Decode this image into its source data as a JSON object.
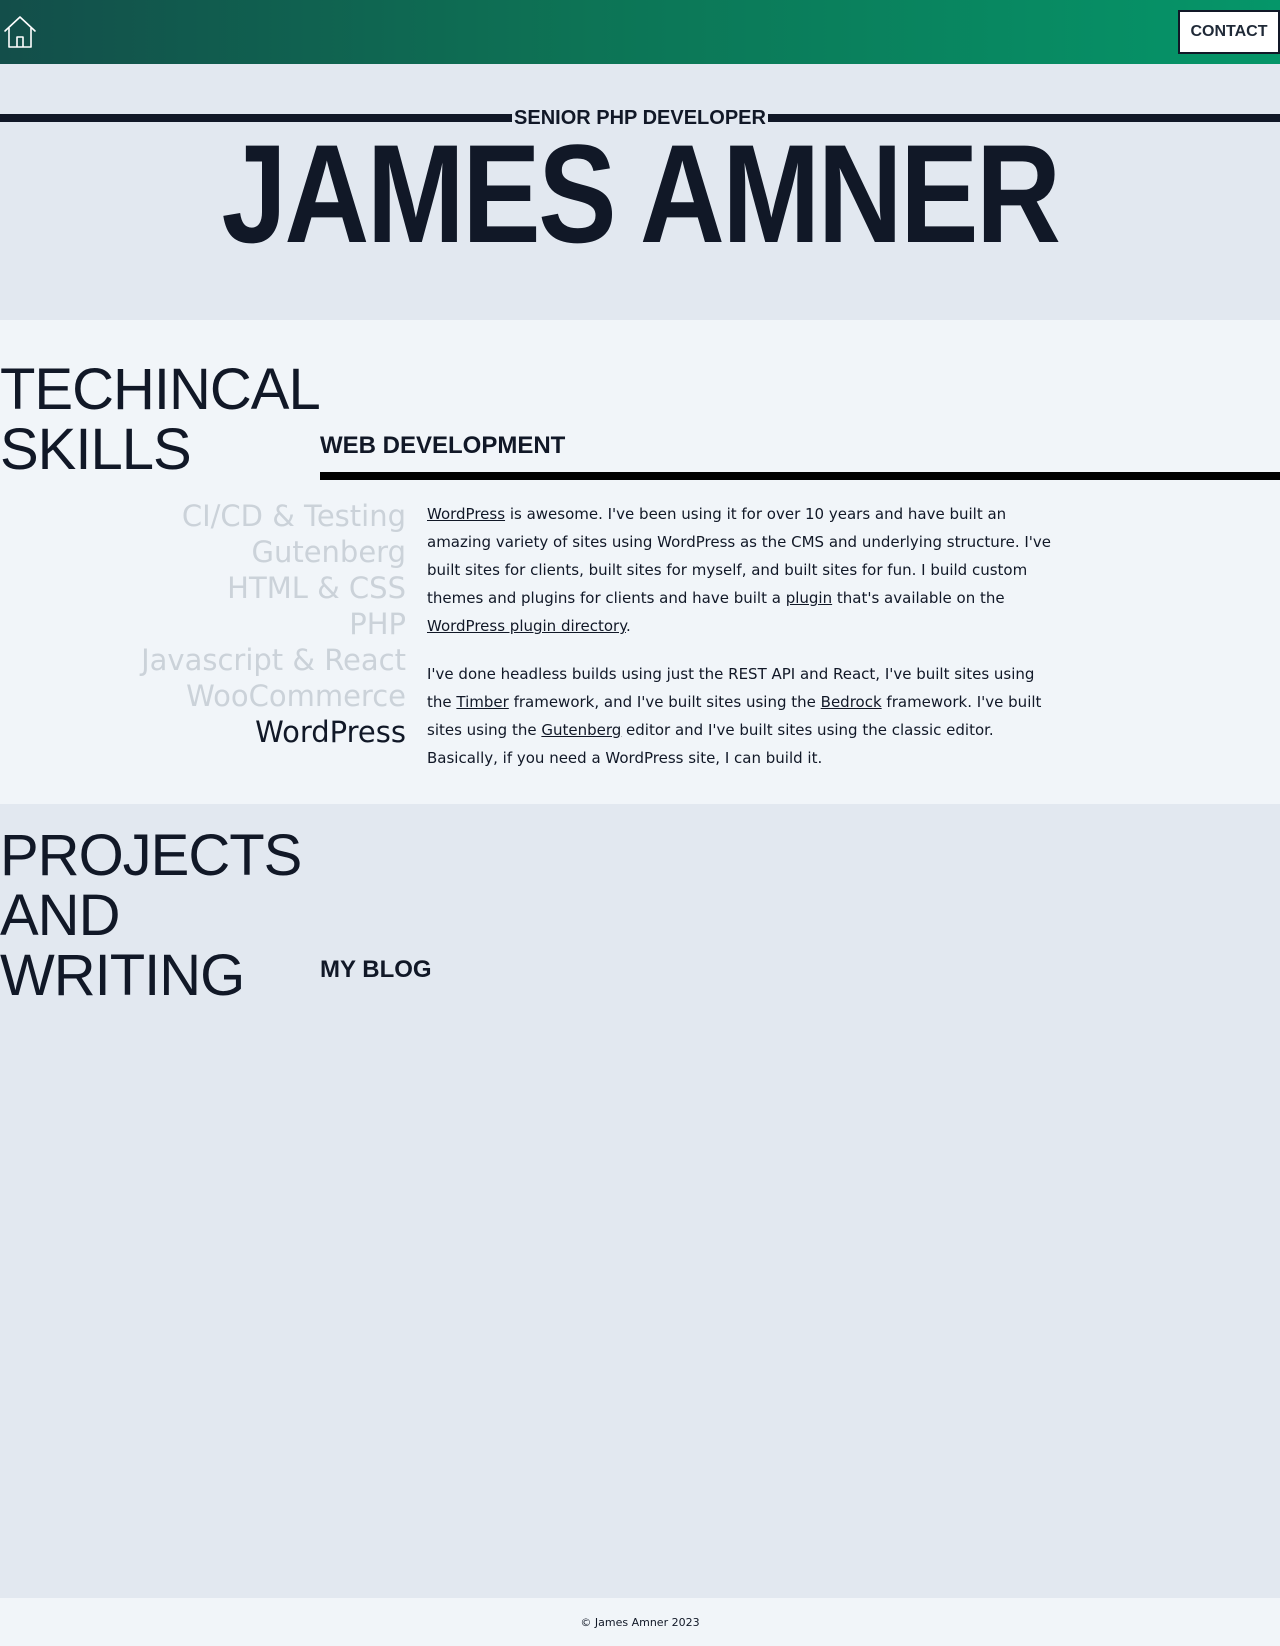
{
  "header": {
    "home_icon": "home-icon",
    "contact_label": "CONTACT",
    "gradient_colors": [
      "#134e4a",
      "#059669"
    ]
  },
  "hero": {
    "subtitle": "SENIOR PHP DEVELOPER",
    "name": "JAMES AMNER"
  },
  "skills": {
    "heading_line1": "TECHINCAL",
    "heading_line2": "SKILLS",
    "items": [
      {
        "label": "CI/CD & Testing",
        "active": false
      },
      {
        "label": "Gutenberg",
        "active": false
      },
      {
        "label": "HTML & CSS",
        "active": false
      },
      {
        "label": "PHP",
        "active": false
      },
      {
        "label": "Javascript & React",
        "active": false
      },
      {
        "label": "WooCommerce",
        "active": false
      },
      {
        "label": "WordPress",
        "active": true
      }
    ],
    "panel": {
      "title": "WEB DEVELOPMENT",
      "p1": {
        "link_wordpress": "WordPress",
        "text1": " is awesome. I've been using it for over 10 years and have built an amazing variety of sites using WordPress as the CMS and underlying structure. I've built sites for clients, built sites for myself, and built sites for fun. I build custom themes and plugins for clients and have built a ",
        "link_plugin": "plugin",
        "text2": " that's available on the ",
        "link_directory": "WordPress plugin directory",
        "text3": "."
      },
      "p2": {
        "text1": "I've done headless builds using just the REST API and React, I've built sites using the ",
        "link_timber": "Timber",
        "text2": " framework, and I've built sites using the ",
        "link_bedrock": "Bedrock",
        "text3": " framework. I've built sites using the ",
        "link_gutenberg": "Gutenberg",
        "text4": " editor and I've built sites using the classic editor. Basically, if you need a WordPress site, I can build it."
      }
    }
  },
  "projects": {
    "heading_line1": "PROJECTS",
    "heading_line2": "AND",
    "heading_line3": "WRITING",
    "blog_title": "MY BLOG"
  },
  "footer": {
    "copyright": "© James Amner 2023"
  },
  "colors": {
    "text": "#111827",
    "muted_skill": "#cbd2d9",
    "hero_bg": "#e2e8f0",
    "section_bg": "#f1f5f9"
  }
}
